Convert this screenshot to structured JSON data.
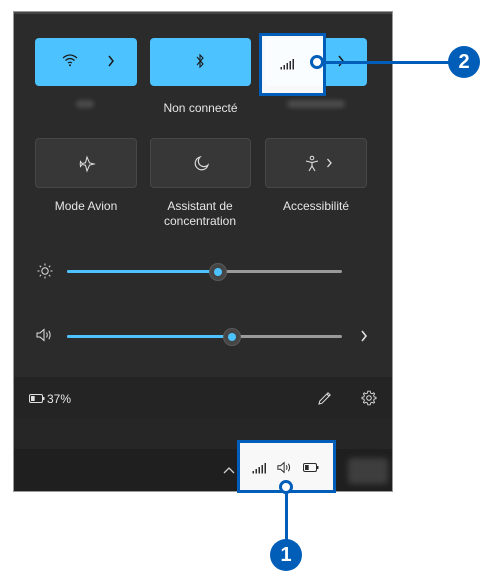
{
  "colors": {
    "accent": "#4cc2ff",
    "panel_bg": "#2b2b2b",
    "callout": "#005eb8"
  },
  "quick_settings": {
    "tiles_row1": [
      {
        "icon": "wifi-icon",
        "has_chevron": true,
        "active": true,
        "label": ""
      },
      {
        "icon": "bluetooth-icon",
        "has_chevron": false,
        "active": true,
        "label": "Non connecté"
      },
      {
        "icon": "cellular-signal-icon",
        "has_chevron": true,
        "active": true,
        "label": ""
      }
    ],
    "tiles_row2": [
      {
        "icon": "airplane-icon",
        "label": "Mode Avion"
      },
      {
        "icon": "moon-icon",
        "label": "Assistant de concentration"
      },
      {
        "icon": "accessibility-icon",
        "label": "Accessibilité"
      }
    ],
    "brightness_level": 0.55,
    "volume_level": 0.6,
    "battery_text": "37%",
    "battery_level": 0.37
  },
  "callouts": {
    "one": "1",
    "two": "2"
  }
}
